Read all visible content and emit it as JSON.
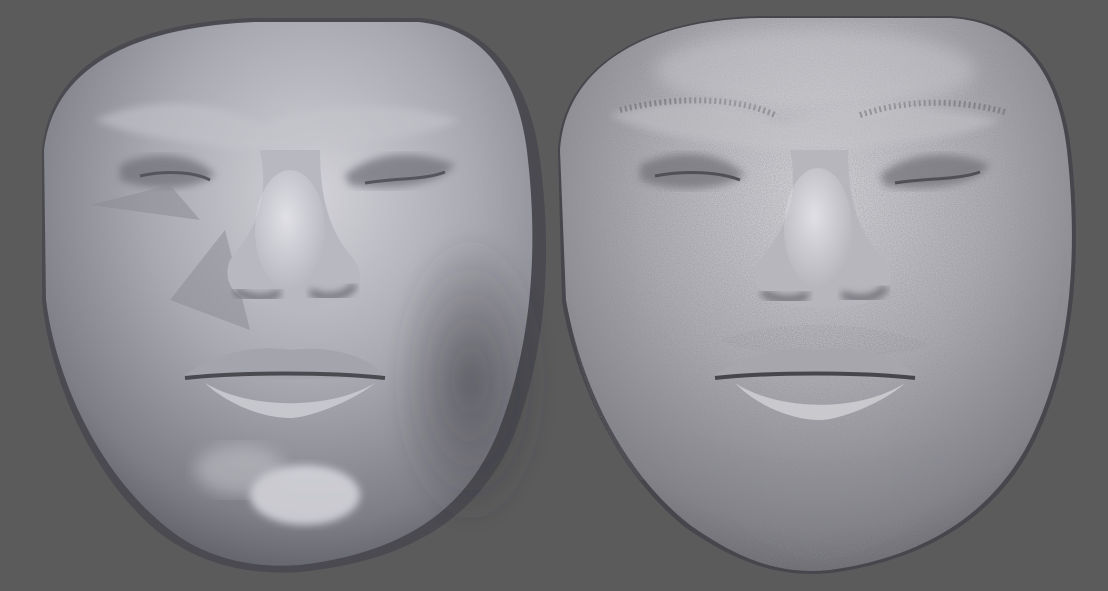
{
  "viewport": {
    "background": "#5b5b5c"
  },
  "models": [
    {
      "id": "smooth-face-model",
      "surface": "smooth",
      "base_color": "#9c9ca4",
      "highlight_color": "#d8d8de",
      "shadow_color": "#3c3c42"
    },
    {
      "id": "detailed-face-model",
      "surface": "detailed",
      "base_color": "#a2a2a8",
      "highlight_color": "#dcdce0",
      "shadow_color": "#404046"
    }
  ]
}
